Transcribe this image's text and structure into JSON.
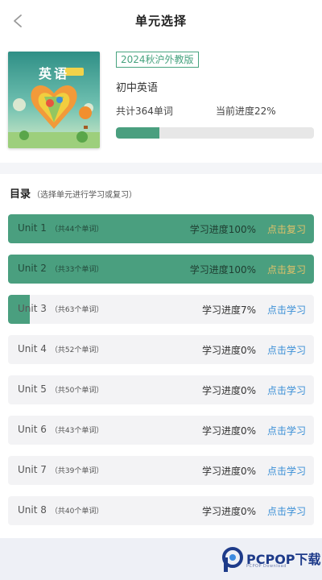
{
  "header": {
    "title": "单元选择"
  },
  "book": {
    "cover_title": "英语",
    "edition": "2024秋沪外教版",
    "name": "初中英语",
    "word_count": "共计364单词",
    "progress_label": "当前进度22%",
    "progress_value": 0.22
  },
  "toc": {
    "title": "目录",
    "subtitle": "（选择单元进行学习或复习）",
    "units": [
      {
        "name": "Unit 1",
        "count": "（共44个单词）",
        "progress": "学习进度100%",
        "action": "点击复习",
        "value": 1.0
      },
      {
        "name": "Unit 2",
        "count": "（共33个单词）",
        "progress": "学习进度100%",
        "action": "点击复习",
        "value": 1.0
      },
      {
        "name": "Unit 3",
        "count": "（共63个单词）",
        "progress": "学习进度7%",
        "action": "点击学习",
        "value": 0.07
      },
      {
        "name": "Unit 4",
        "count": "（共52个单词）",
        "progress": "学习进度0%",
        "action": "点击学习",
        "value": 0.0
      },
      {
        "name": "Unit 5",
        "count": "（共50个单词）",
        "progress": "学习进度0%",
        "action": "点击学习",
        "value": 0.0
      },
      {
        "name": "Unit 6",
        "count": "（共43个单词）",
        "progress": "学习进度0%",
        "action": "点击学习",
        "value": 0.0
      },
      {
        "name": "Unit 7",
        "count": "（共39个单词）",
        "progress": "学习进度0%",
        "action": "点击学习",
        "value": 0.0
      },
      {
        "name": "Unit 8",
        "count": "（共40个单词）",
        "progress": "学习进度0%",
        "action": "点击学习",
        "value": 0.0
      }
    ]
  },
  "watermark": {
    "text": "PCPOP下载"
  },
  "colors": {
    "accent": "#4a9f7f",
    "review_action": "#e0c16a",
    "learn_action": "#3a8fd6"
  }
}
